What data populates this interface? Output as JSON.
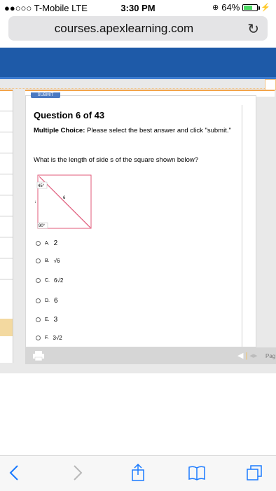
{
  "status_bar": {
    "carrier": "●●○○○ T-Mobile  LTE",
    "time": "3:30 PM",
    "battery_percent": "64%",
    "battery_level": 0.64
  },
  "address_bar": {
    "url": "courses.apexlearning.com"
  },
  "question": {
    "title": "Question 6 of 43",
    "type_label": "Multiple Choice:",
    "instructions": "Please select the best answer and click \"submit.\"",
    "prompt": "What is the length of side s of the square shown below?",
    "figure": {
      "angle_top": "45°",
      "angle_bottom": "90°",
      "diagonal_label": "6",
      "side_label": "s"
    },
    "choices": [
      {
        "label": "A.",
        "value": "2"
      },
      {
        "label": "B.",
        "value": "√6"
      },
      {
        "label": "C.",
        "value": "6√2"
      },
      {
        "label": "D.",
        "value": "6"
      },
      {
        "label": "E.",
        "value": "3"
      },
      {
        "label": "F.",
        "value": "3√2"
      }
    ]
  },
  "toolbar": {
    "page_label": "Pag"
  },
  "colors": {
    "header_blue": "#1e5aa8",
    "accent_orange": "#f3a54c",
    "diagonal_pink": "#e05a7a"
  }
}
